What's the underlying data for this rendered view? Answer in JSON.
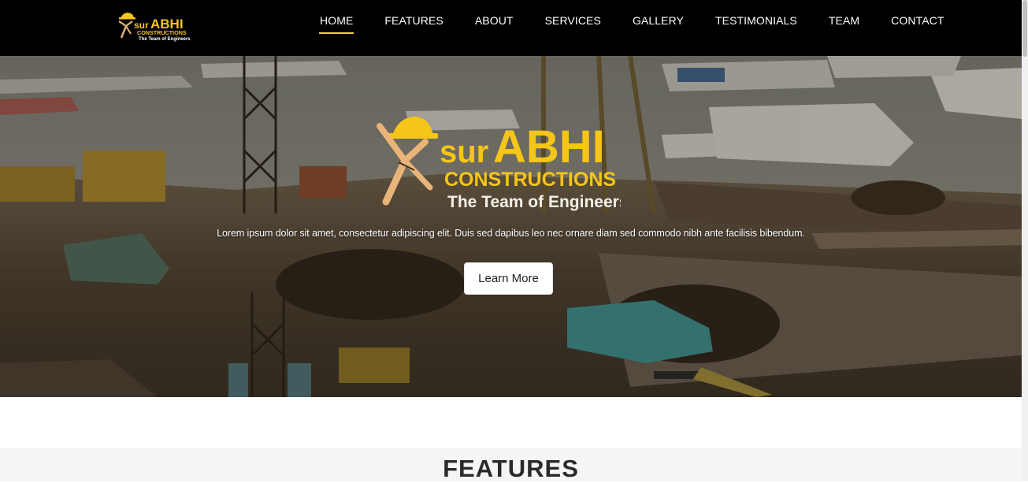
{
  "colors": {
    "navbar_bg": "#000000",
    "accent_yellow": "#f2d230",
    "logo_yellow": "#f5c518",
    "features_bg": "#f5f5f5",
    "button_bg": "#ffffff"
  },
  "brand": {
    "name_prefix": "sur",
    "name_main": "ABHI",
    "subtitle": "CONSTRUCTIONS",
    "tagline": "The Team of Engineers",
    "icon": "builder-hardhat-icon"
  },
  "nav": {
    "items": [
      {
        "label": "HOME",
        "active": true
      },
      {
        "label": "FEATURES",
        "active": false
      },
      {
        "label": "ABOUT",
        "active": false
      },
      {
        "label": "SERVICES",
        "active": false
      },
      {
        "label": "GALLERY",
        "active": false
      },
      {
        "label": "TESTIMONIALS",
        "active": false
      },
      {
        "label": "TEAM",
        "active": false
      },
      {
        "label": "CONTACT",
        "active": false
      }
    ]
  },
  "hero": {
    "description": "Lorem ipsum dolor sit amet, consectetur adipiscing elit. Duis sed dapibus leo nec ornare diam sed commodo nibh ante facilisis bibendum.",
    "cta_label": "Learn More",
    "background": "construction-site-harbor-photo"
  },
  "features": {
    "title": "FEATURES"
  }
}
